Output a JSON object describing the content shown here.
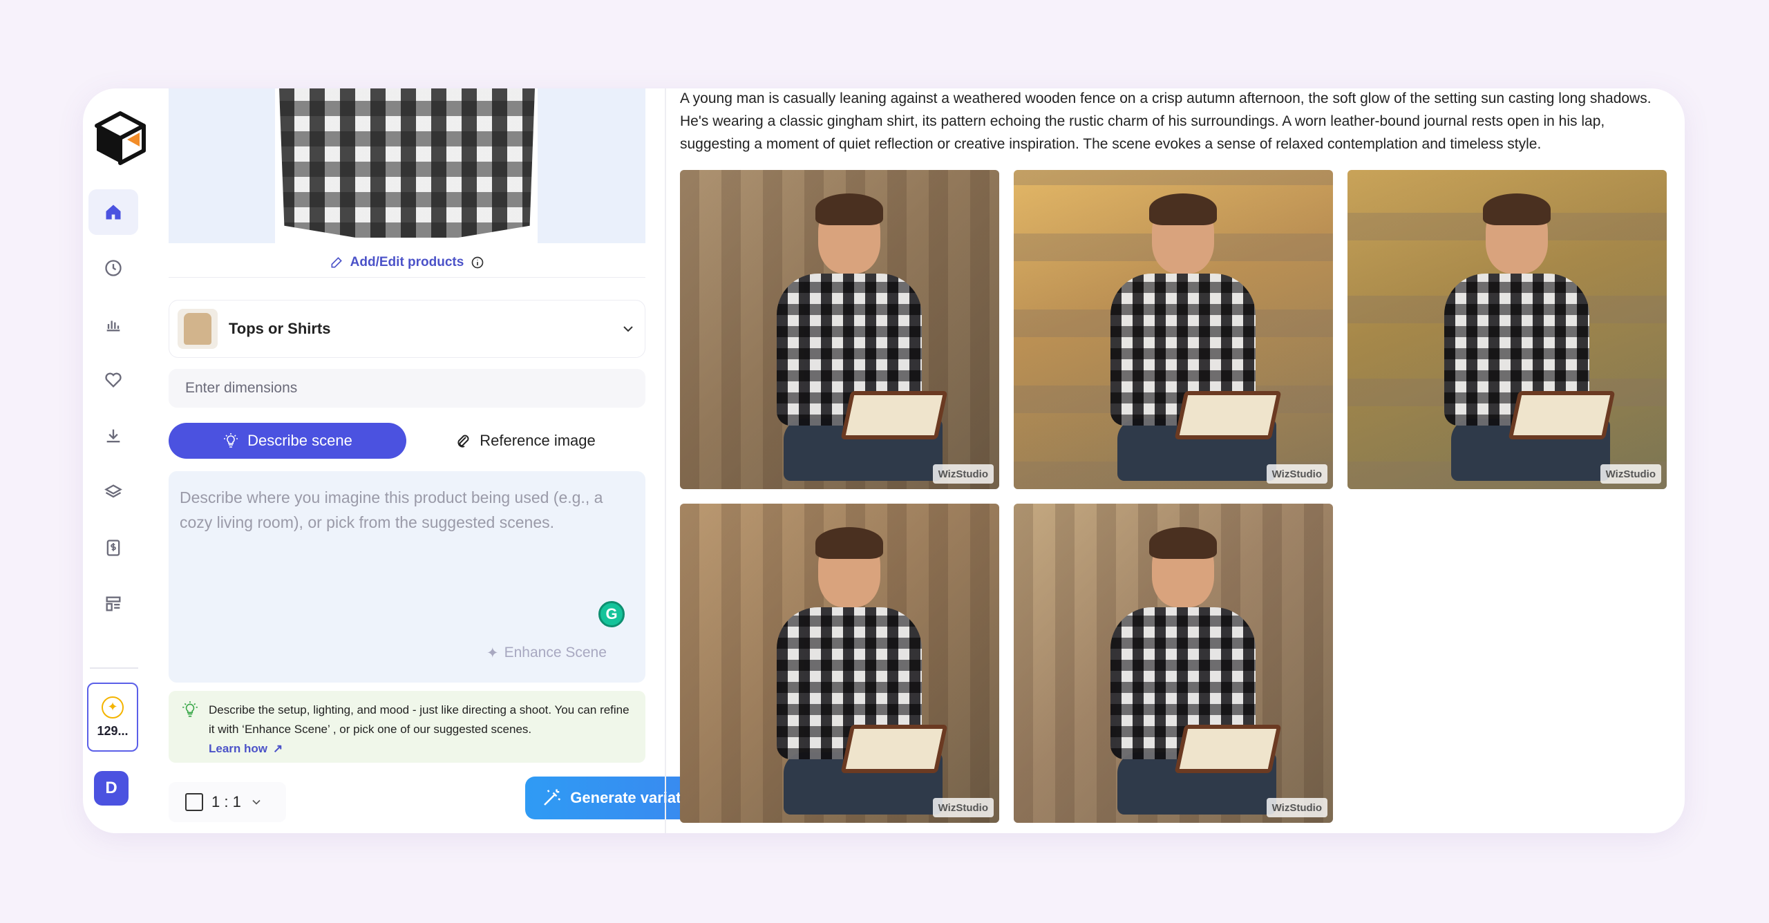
{
  "sidebar": {
    "items": [
      {
        "name": "home",
        "icon": "home-icon",
        "active": true
      },
      {
        "name": "history",
        "icon": "clock-icon",
        "active": false
      },
      {
        "name": "analytics",
        "icon": "chart-icon",
        "active": false
      },
      {
        "name": "favorites",
        "icon": "heart-icon",
        "active": false
      },
      {
        "name": "downloads",
        "icon": "download-icon",
        "active": false
      },
      {
        "name": "layers",
        "icon": "layers-icon",
        "active": false
      },
      {
        "name": "billing",
        "icon": "dollar-doc-icon",
        "active": false
      },
      {
        "name": "templates",
        "icon": "template-icon",
        "active": false
      }
    ],
    "credits": "129...",
    "avatar_initial": "D"
  },
  "panel": {
    "add_edit_label": "Add/Edit products",
    "category_label": "Tops or Shirts",
    "dimensions_placeholder": "Enter dimensions",
    "tabs": [
      {
        "label": "Describe scene",
        "active": true
      },
      {
        "label": "Reference image",
        "active": false
      }
    ],
    "scene_placeholder": "Describe where you imagine this product being used (e.g., a cozy living room), or pick from the suggested scenes.",
    "enhance_label": "Enhance Scene",
    "hint_text": "Describe the setup, lighting, and mood - just like directing a shoot. You can refine it with ‘Enhance Scene’ , or pick one of our suggested scenes.",
    "learn_how": "Learn how",
    "ratio_label": "1 : 1",
    "generate_label": "Generate variations"
  },
  "content": {
    "description": "A young man is casually leaning against a weathered wooden fence on a crisp autumn afternoon, the soft glow of the setting sun casting long shadows. He's wearing a classic gingham shirt, its pattern echoing the rustic charm of his surroundings. A worn leather-bound journal rests open in his lap, suggesting a moment of quiet reflection or creative inspiration. The scene evokes a sense of relaxed contemplation and timeless style.",
    "images": [
      {
        "watermark": "WizStudio"
      },
      {
        "watermark": "WizStudio"
      },
      {
        "watermark": "WizStudio"
      },
      {
        "watermark": "WizStudio"
      },
      {
        "watermark": "WizStudio"
      }
    ]
  },
  "colors": {
    "accent": "#4b52e0",
    "generate_button": "#3b86ef",
    "hint_bg": "#f0f7ea",
    "scene_bg": "#eef3fb"
  }
}
